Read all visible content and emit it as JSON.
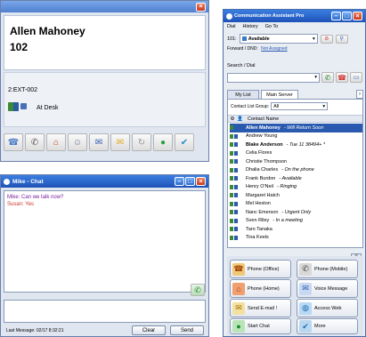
{
  "contact_panel": {
    "name": "Allen Mahoney",
    "extension": "102",
    "line": "2:EXT-002",
    "status": "At Desk",
    "toolbar_icons": [
      "phone-icon",
      "handset-icon",
      "house-icon",
      "person-icon",
      "email-icon",
      "envelope-icon",
      "refresh-icon",
      "chat-icon",
      "check-icon"
    ]
  },
  "chat": {
    "title": "Mike - Chat",
    "messages": [
      {
        "sender": "Mike",
        "text": "Can we talk now?",
        "color": "#7a1fa0"
      },
      {
        "sender": "Susan",
        "text": "Yes",
        "color": "#d0342c"
      }
    ],
    "last_message": "Last Message: 02/17 8:32:21",
    "clear_label": "Clear",
    "send_label": "Send"
  },
  "assistant": {
    "title": "Communication Assistant Pro",
    "menu": [
      "Dial",
      "History",
      "Go To"
    ],
    "ext_label": "101:",
    "availability": "Available",
    "forward_label": "Forward / DND:",
    "forward_value": "Not Assigned",
    "search_label": "Search / Dial",
    "tabs": [
      "My List",
      "Main Server"
    ],
    "group_label": "Contact List Group:",
    "group_value": "All",
    "column_header": "Contact Name",
    "contacts": [
      {
        "name": "Allen Mahoney",
        "status": "- Will Return Soon",
        "selected": true
      },
      {
        "name": "Andrew Young",
        "status": ""
      },
      {
        "name": "Blake Anderson",
        "status": "- Tue 11 38494+ *",
        "bold": true
      },
      {
        "name": "Celia Flores",
        "status": ""
      },
      {
        "name": "Christie Thompson",
        "status": ""
      },
      {
        "name": "Dhalia Charles",
        "status": "- On the phone"
      },
      {
        "name": "Frank Burdon",
        "status": "- Available"
      },
      {
        "name": "Henry O'Neil",
        "status": "- Ringing"
      },
      {
        "name": "Margaret Hatch",
        "status": ""
      },
      {
        "name": "Mel Heston",
        "status": ""
      },
      {
        "name": "Nanc Emerson",
        "status": "- Urgent Only"
      },
      {
        "name": "Sven Riley",
        "status": "- In a meeting"
      },
      {
        "name": "Taro Tanaka",
        "status": ""
      },
      {
        "name": "Tina Keels",
        "status": ""
      }
    ],
    "actions": [
      {
        "label": "Phone (Office)",
        "icon": "phone-office-icon",
        "color": "#e8a040"
      },
      {
        "label": "Phone (Mobile)",
        "icon": "mobile-phone-icon",
        "color": "#8a8a8a"
      },
      {
        "label": "Phone (Home)",
        "icon": "house-icon",
        "color": "#d04a20"
      },
      {
        "label": "Voice Message",
        "icon": "voice-message-icon",
        "color": "#4a7ac8"
      },
      {
        "label": "Send E-mail !",
        "icon": "email-icon",
        "color": "#e8c040"
      },
      {
        "label": "Access Web",
        "icon": "globe-icon",
        "color": "#3a8ad8"
      },
      {
        "label": "Start Chat",
        "icon": "chat-icon",
        "color": "#30a040"
      },
      {
        "label": "More",
        "icon": "check-icon",
        "color": "#2a8ad0"
      }
    ]
  }
}
